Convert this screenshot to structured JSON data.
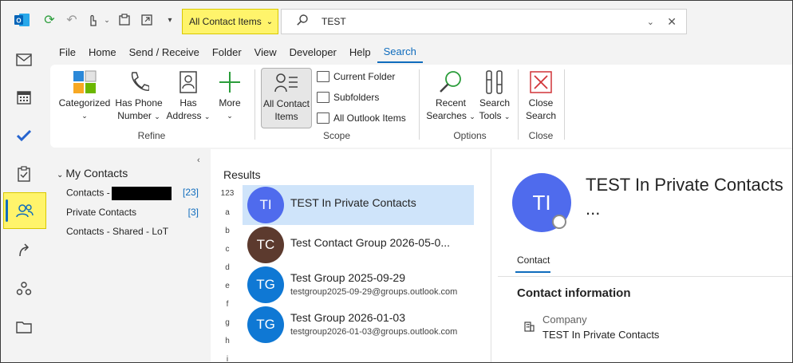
{
  "search": {
    "scope_label": "All Contact Items",
    "query": "TEST"
  },
  "menu": [
    "File",
    "Home",
    "Send / Receive",
    "Folder",
    "View",
    "Developer",
    "Help",
    "Search"
  ],
  "ribbon": {
    "refine": {
      "categorized": "Categorized",
      "has_phone_1": "Has Phone",
      "has_phone_2": "Number",
      "has_address_1": "Has",
      "has_address_2": "Address",
      "more": "More",
      "label": "Refine"
    },
    "scope": {
      "all_contact_items_1": "All Contact",
      "all_contact_items_2": "Items",
      "current_folder": "Current Folder",
      "subfolders": "Subfolders",
      "all_outlook_items": "All Outlook Items",
      "label": "Scope"
    },
    "options": {
      "recent_searches_1": "Recent",
      "recent_searches_2": "Searches",
      "search_tools_1": "Search",
      "search_tools_2": "Tools",
      "label": "Options"
    },
    "close": {
      "close_search_1": "Close",
      "close_search_2": "Search",
      "label": "Close"
    }
  },
  "folders": {
    "heading": "My Contacts",
    "items": [
      {
        "label": "Contacts -",
        "count": "[23]"
      },
      {
        "label": "Private Contacts",
        "count": "[3]"
      },
      {
        "label": "Contacts - Shared - LoT",
        "count": ""
      }
    ]
  },
  "results": {
    "title": "Results",
    "alpha_index": [
      "123",
      "a",
      "b",
      "c",
      "d",
      "e",
      "f",
      "g",
      "h",
      "i"
    ],
    "rows": [
      {
        "initials": "TI",
        "name": "TEST In Private Contacts",
        "email": "",
        "color": "#4f6bed"
      },
      {
        "initials": "TC",
        "name": "Test Contact Group 2026-05-0...",
        "email": "",
        "color": "#5c3a2e"
      },
      {
        "initials": "TG",
        "name": "Test Group 2025-09-29",
        "email": "testgroup2025-09-29@groups.outlook.com",
        "color": "#0f78d4"
      },
      {
        "initials": "TG",
        "name": "Test Group 2026-01-03",
        "email": "testgroup2026-01-03@groups.outlook.com",
        "color": "#0f78d4"
      }
    ]
  },
  "reading": {
    "initials": "TI",
    "name": "TEST In Private Contacts",
    "ellipsis": "...",
    "tab": "Contact",
    "section": "Contact information",
    "field_label": "Company",
    "field_value": "TEST In Private Contacts"
  },
  "colors": {
    "accent": "#0f6cbd",
    "highlight": "#fff46b",
    "selected_row": "#cfe4fa"
  }
}
